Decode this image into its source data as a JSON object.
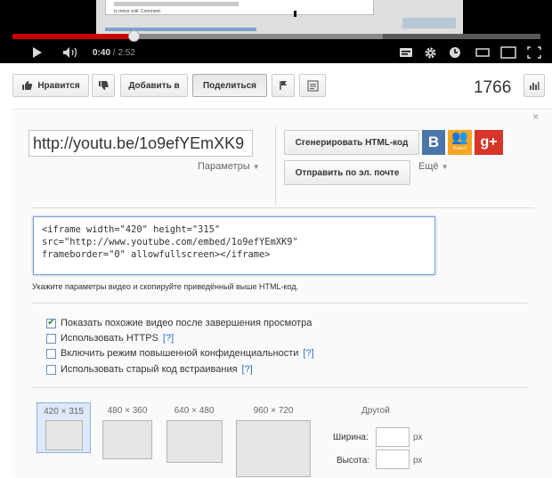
{
  "player": {
    "time_current": "0:40",
    "time_total": "/ 2:52",
    "progress": 0.23,
    "thumb_text": "Is minor edit: Comment:"
  },
  "actions": {
    "like_label": "Нравится",
    "addto_label": "Добавить в",
    "share_label": "Поделиться",
    "view_count": "1766"
  },
  "share": {
    "short_url": "http://youtu.be/1o9efYEmXK9",
    "params_label": "Параметры",
    "generate_html_label": "Сгенерировать HTML-код",
    "email_label": "Отправить по эл. почте",
    "more_label": "Ещё",
    "vk_label": "B",
    "ok_label": "Класс!",
    "gplus_label": "g+",
    "close_label": "×"
  },
  "embed": {
    "code": "<iframe width=\"420\" height=\"315\"\nsrc=\"http://www.youtube.com/embed/1o9efYEmXK9\"\nframeborder=\"0\" allowfullscreen></iframe>",
    "hint": "Укажите параметры видео и скопируйте приведённый выше HTML-код."
  },
  "options": [
    {
      "label": "Показать похожие видео после завершения просмотра",
      "checked": true,
      "help": ""
    },
    {
      "label": "Использовать HTTPS",
      "checked": false,
      "help": "[?]"
    },
    {
      "label": "Включить режим повышенной конфиденциальности",
      "checked": false,
      "help": "[?]"
    },
    {
      "label": "Использовать старый код встраивания",
      "checked": false,
      "help": "[?]"
    }
  ],
  "sizes": [
    {
      "label": "420 × 315",
      "selected": true
    },
    {
      "label": "480 × 360",
      "selected": false
    },
    {
      "label": "640 × 480",
      "selected": false
    },
    {
      "label": "960 × 720",
      "selected": false
    }
  ],
  "custom_size": {
    "title": "Другой",
    "width_label": "Ширина:",
    "height_label": "Высота:",
    "unit": "px"
  }
}
